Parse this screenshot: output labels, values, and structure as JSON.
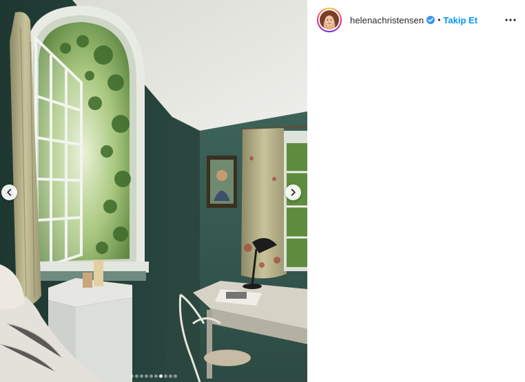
{
  "post": {
    "photo_alt": "",
    "carousel": {
      "total": 10,
      "active_index": 7
    },
    "nav": {
      "prev_icon": "chevron-left-icon",
      "next_icon": "chevron-right-icon"
    }
  },
  "header": {
    "username": "helenachristensen",
    "verified_icon": "verified-badge-icon",
    "separator": "•",
    "follow_label": "Takip Et",
    "more_icon": "more-options-icon"
  },
  "colors": {
    "follow": "#0095f6",
    "text": "#262626",
    "verified": "#3897f0"
  }
}
